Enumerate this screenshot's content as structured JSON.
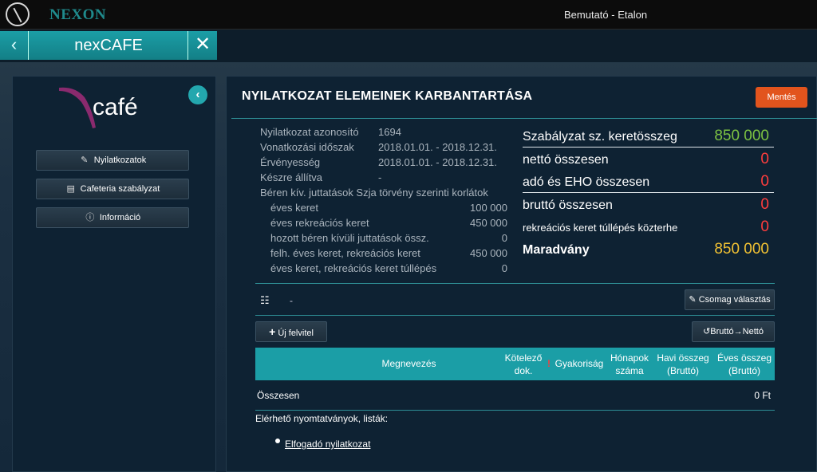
{
  "topbar": {
    "brand": "NEXON",
    "environment": "Bemutató - Etalon"
  },
  "app_tab": {
    "title": "nexCAFE",
    "back_icon": "chevron-left-icon",
    "close_icon": "close-icon"
  },
  "sidebar": {
    "logo_text": "café",
    "buttons": [
      {
        "label": "Nyilatkozatok",
        "icon": "document-edit-icon"
      },
      {
        "label": "Cafeteria szabályzat",
        "icon": "book-icon"
      },
      {
        "label": "Információ",
        "icon": "info-icon"
      }
    ]
  },
  "main": {
    "title": "NYILATKOZAT ELEMEINEK KARBANTARTÁSA",
    "save_label": "Mentés",
    "info": [
      {
        "label": "Nyilatkozat azonosító",
        "value": "1694"
      },
      {
        "label": "Vonatkozási időszak",
        "value": "2018.01.01. - 2018.12.31."
      },
      {
        "label": "Érvényesség",
        "value": "2018.01.01. - 2018.12.31."
      },
      {
        "label": "Készre állítva",
        "value": "-"
      }
    ],
    "limits_title": "Béren kív. juttatások Szja törvény szerinti korlátok",
    "limits": [
      {
        "label": "éves keret",
        "value": "100 000"
      },
      {
        "label": "éves rekreációs keret",
        "value": "450 000"
      },
      {
        "label": "hozott béren kívüli juttatások össz.",
        "value": "0"
      },
      {
        "label": "felh. éves keret, rekreációs keret",
        "value": "450 000"
      },
      {
        "label": "éves keret, rekreációs keret túllépés",
        "value": "0"
      }
    ],
    "summary": [
      {
        "label": "Szabályzat sz. keretösszeg",
        "value": "850 000",
        "color": "#7cc242"
      },
      {
        "label": "nettó összesen",
        "value": "0",
        "color": "#ff3d3d"
      },
      {
        "label": "adó és EHO összesen",
        "value": "0",
        "color": "#ff3d3d"
      },
      {
        "label": "bruttó összesen",
        "value": "0",
        "color": "#ff3d3d"
      },
      {
        "label": "rekreációs keret túllépés közterhe",
        "value": "0",
        "color": "#ff3d3d"
      },
      {
        "label": "Maradvány",
        "value": "850 000",
        "color": "#f2c233"
      }
    ],
    "package_value": "-",
    "package_button": "Csomag választás",
    "new_button": "Új felvitel",
    "gross_net_from": "Bruttó",
    "gross_net_to": "Nettó",
    "table_headers": {
      "name": "Megnevezés",
      "mandatory_1": "Kötelező",
      "mandatory_2": "dok.",
      "mandatory_mark": "!",
      "frequency": "Gyakoriság",
      "months_1": "Hónapok",
      "months_2": "száma",
      "monthly_1": "Havi összeg",
      "monthly_2": "(Bruttó)",
      "yearly_1": "Éves összeg",
      "yearly_2": "(Bruttó)"
    },
    "total_label": "Összesen",
    "total_value": "0 Ft",
    "forms_label": "Elérhető nyomtatványok, listák:",
    "forms": [
      "Elfogadó nyilatkozat"
    ]
  }
}
